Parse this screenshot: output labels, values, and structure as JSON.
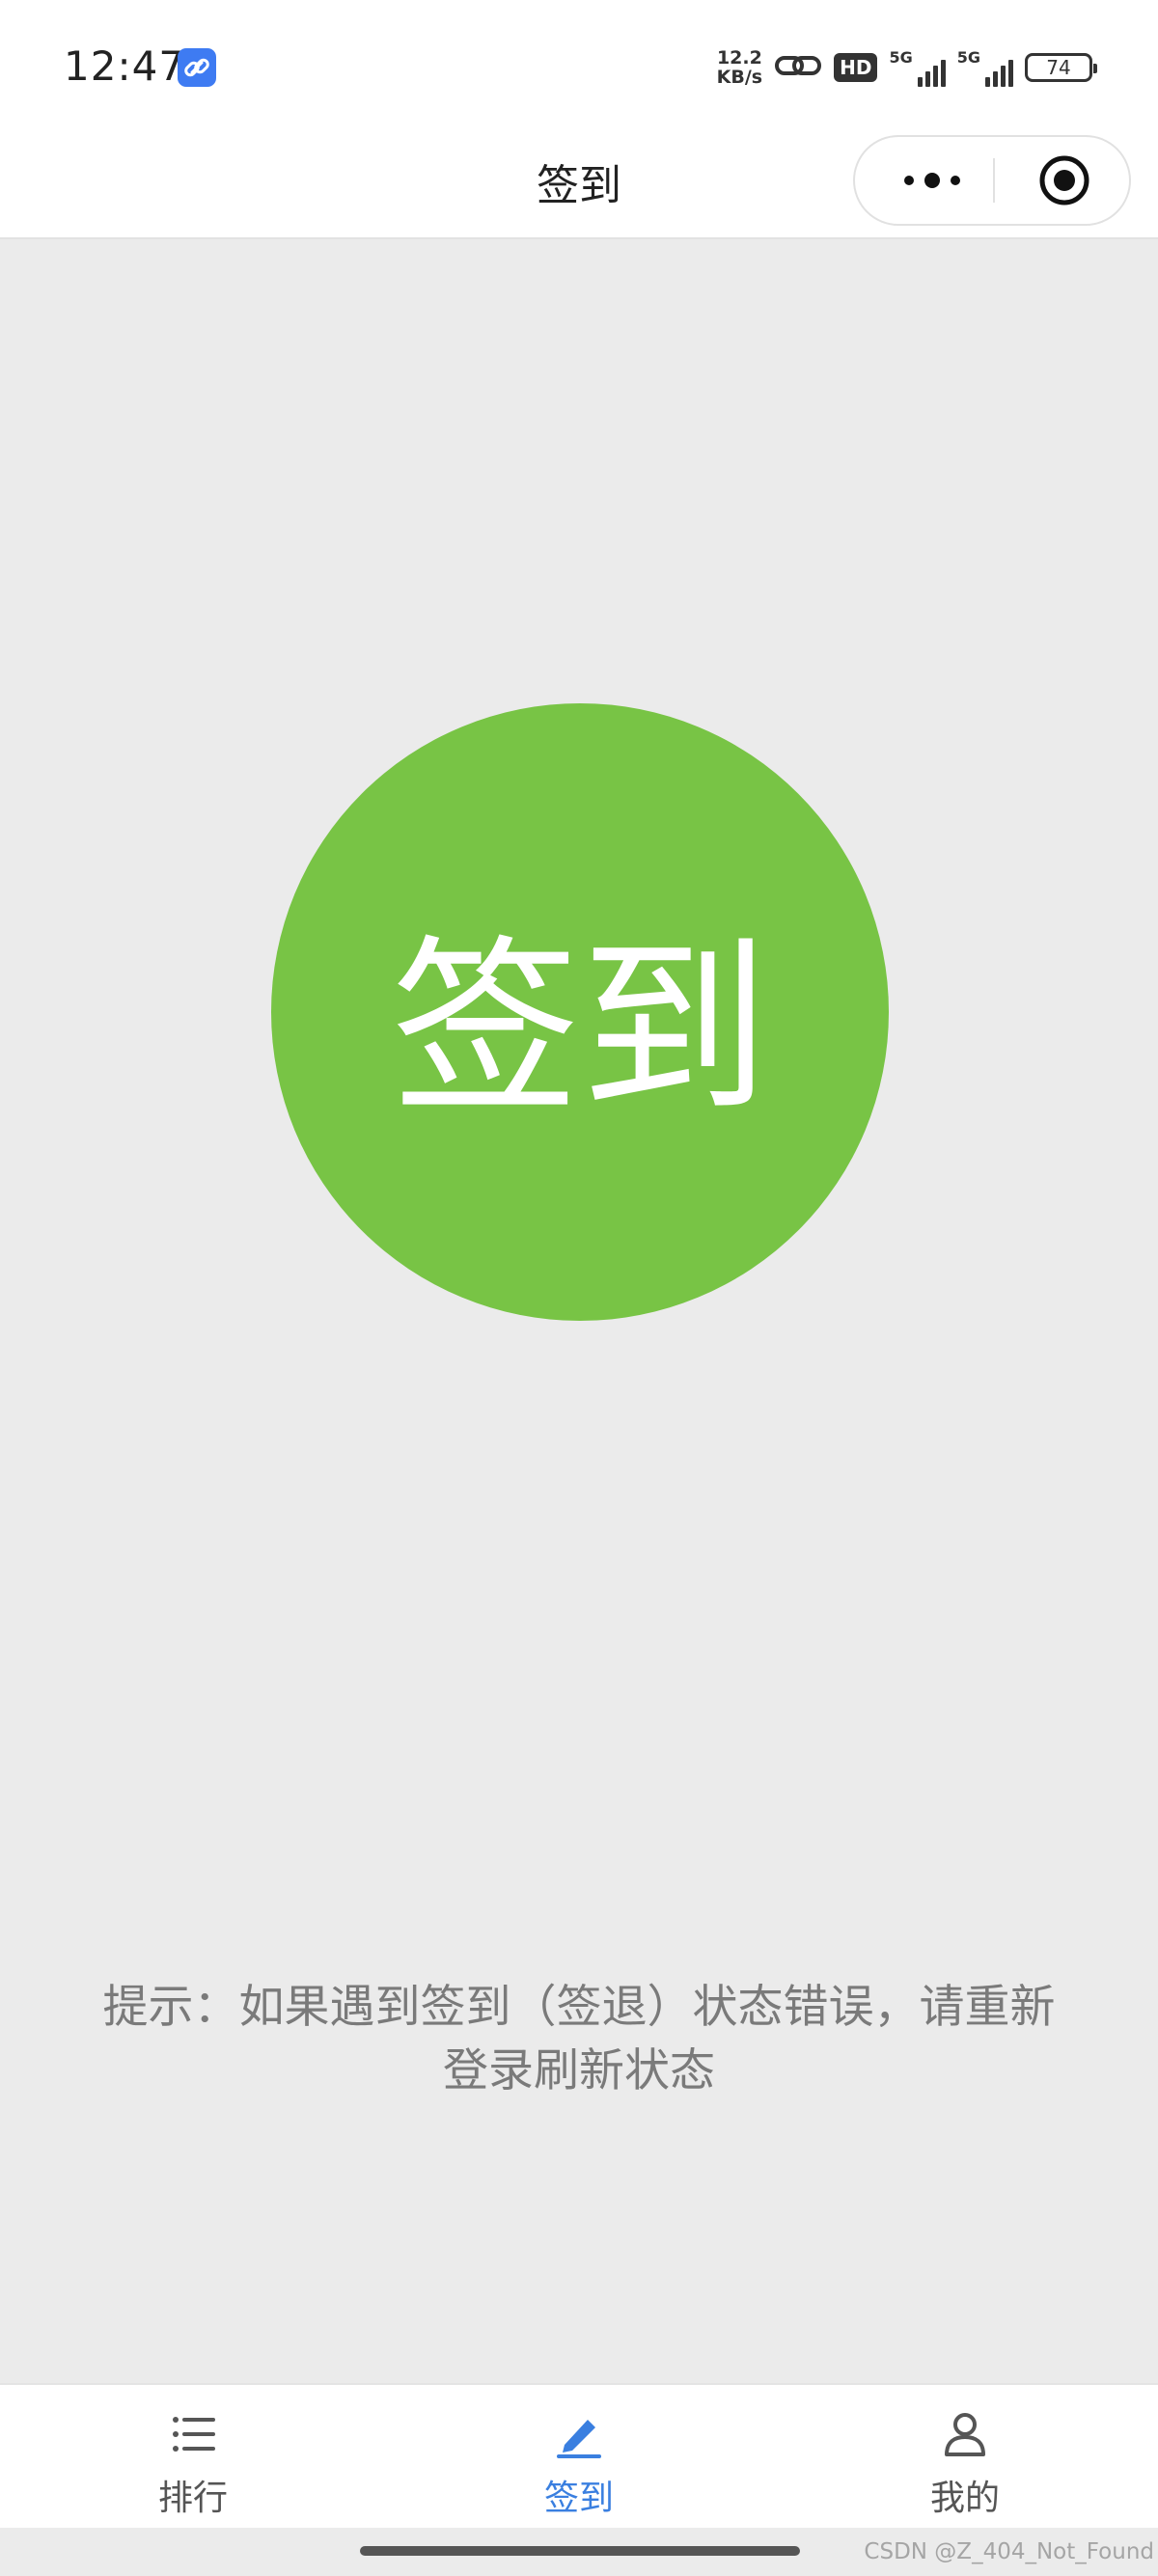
{
  "status_bar": {
    "time": "12:47",
    "net_speed_value": "12.2",
    "net_speed_unit": "KB/s",
    "hd_label": "HD",
    "sim1_label": "5G",
    "sim2_label": "5G",
    "battery": "74"
  },
  "nav": {
    "title": "签到",
    "capsule_more_icon": "more-dots-icon",
    "capsule_close_icon": "target-circle-icon"
  },
  "main": {
    "sign_button_label": "签到",
    "hint": "提示：如果遇到签到（签退）状态错误，请重新登录刷新状态"
  },
  "tabs": [
    {
      "label": "排行",
      "icon": "list-icon",
      "active": false
    },
    {
      "label": "签到",
      "icon": "pen-icon",
      "active": true
    },
    {
      "label": "我的",
      "icon": "user-icon",
      "active": false
    }
  ],
  "watermark": "CSDN @Z_404_Not_Found",
  "colors": {
    "accent": "#78c445",
    "tab_active": "#3a7fe0",
    "background": "#ebebeb"
  }
}
